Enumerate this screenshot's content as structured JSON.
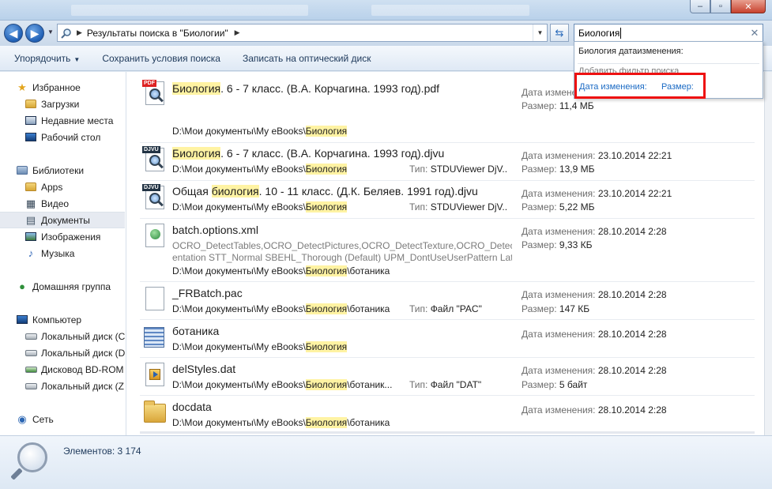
{
  "nav": {
    "address_path": "Результаты поиска в \"Биологии\"",
    "search_value": "Биология"
  },
  "toolbar": {
    "organize": "Упорядочить",
    "save_search": "Сохранить условия поиска",
    "burn": "Записать на оптический диск"
  },
  "sidebar": {
    "items": [
      {
        "label": "Избранное",
        "icon": "star-icon"
      },
      {
        "label": "Загрузки",
        "icon": "downloads-folder-icon"
      },
      {
        "label": "Недавние места",
        "icon": "recent-places-icon"
      },
      {
        "label": "Рабочий стол",
        "icon": "desktop-icon"
      },
      {
        "label": "Библиотеки",
        "icon": "libraries-icon"
      },
      {
        "label": "Apps",
        "icon": "folder-icon"
      },
      {
        "label": "Видео",
        "icon": "video-icon"
      },
      {
        "label": "Документы",
        "icon": "documents-icon"
      },
      {
        "label": "Изображения",
        "icon": "pictures-icon"
      },
      {
        "label": "Музыка",
        "icon": "music-icon"
      },
      {
        "label": "Домашняя группа",
        "icon": "homegroup-icon"
      },
      {
        "label": "Компьютер",
        "icon": "computer-icon"
      },
      {
        "label": "Локальный диск (C",
        "icon": "drive-icon"
      },
      {
        "label": "Локальный диск (D",
        "icon": "drive-icon"
      },
      {
        "label": "Дисковод BD-ROM",
        "icon": "bd-rom-icon"
      },
      {
        "label": "Локальный диск (Z",
        "icon": "drive-icon"
      },
      {
        "label": "Сеть",
        "icon": "network-icon"
      }
    ],
    "selected": "Документы"
  },
  "labels": {
    "date_modified": "Дата изменения:",
    "size": "Размер:",
    "type": "Тип:"
  },
  "files": [
    {
      "icon": "pdf-file-icon",
      "name_hl": "Биология",
      "name_rest": ". 6 - 7 класс. (В.А. Корчагина. 1993 год).pdf",
      "path_pre": "D:\\Мои документы\\My eBooks\\",
      "path_hl": "Биология",
      "path_post": "",
      "type": "",
      "date": "",
      "size": "11,4 МБ"
    },
    {
      "icon": "djvu-file-icon",
      "name_hl": "Биология",
      "name_rest": ". 6 - 7 класс. (В.А. Корчагина. 1993 год).djvu",
      "path_pre": "D:\\Мои документы\\My eBooks\\",
      "path_hl": "Биология",
      "path_post": "",
      "type": "STDUViewer DjV...",
      "date": "23.10.2014 22:21",
      "size": "13,9 МБ"
    },
    {
      "icon": "djvu-file-icon",
      "name_pre": "Общая ",
      "name_hl": "биология",
      "name_rest": ". 10 - 11 класс. (Д.К. Беляев. 1991 год).djvu",
      "path_pre": "D:\\Мои документы\\My eBooks\\",
      "path_hl": "Биология",
      "path_post": "",
      "type": "STDUViewer DjV...",
      "date": "23.10.2014 22:21",
      "size": "5,22 МБ"
    },
    {
      "icon": "xml-file-icon",
      "name_rest": "batch.options.xml",
      "desc1": "OCRO_DetectTables,OCRO_DetectPictures,OCRO_DetectTexture,OCRO_DetectOri",
      "desc2": "entation STT_Normal SBEHL_Thorough (Default) UPM_DontUseUserPattern Lati...",
      "path_pre": "D:\\Мои документы\\My eBooks\\",
      "path_hl": "Биология",
      "path_post": "\\ботаника",
      "type": "",
      "date": "28.10.2014 2:28",
      "size": "9,33 КБ"
    },
    {
      "icon": "blank-file-icon",
      "name_rest": "_FRBatch.pac",
      "path_pre": "D:\\Мои документы\\My eBooks\\",
      "path_hl": "Биология",
      "path_post": "\\ботаника",
      "type": "Файл \"PAC\"",
      "date": "28.10.2014 2:28",
      "size": "147 КБ"
    },
    {
      "icon": "document-stack-icon",
      "name_rest": "ботаника",
      "path_pre": "D:\\Мои документы\\My eBooks\\",
      "path_hl": "Биология",
      "path_post": "",
      "type": "",
      "date": "28.10.2014 2:28",
      "size": ""
    },
    {
      "icon": "media-file-icon",
      "name_rest": "delStyles.dat",
      "path_pre": "D:\\Мои документы\\My eBooks\\",
      "path_hl": "Биология",
      "path_post": "\\ботаник...",
      "type": "Файл \"DAT\"",
      "date": "28.10.2014 2:28",
      "size": "5 байт"
    },
    {
      "icon": "folder-icon",
      "name_rest": "docdata",
      "path_pre": "D:\\Мои документы\\My eBooks\\",
      "path_hl": "Биология",
      "path_post": "\\ботаника",
      "type": "",
      "date": "28.10.2014 2:28",
      "size": ""
    }
  ],
  "status": {
    "count": "Элементов: 3 174"
  },
  "suggest": {
    "item": "Биология датаизменения:",
    "add_filter": "Добавить фильтр поиска",
    "filter_date": "Дата изменения:",
    "filter_size": "Размер:"
  },
  "colors": {
    "highlight": "#fff3a3",
    "filter_border": "#e11111",
    "link": "#1a6ac4"
  }
}
